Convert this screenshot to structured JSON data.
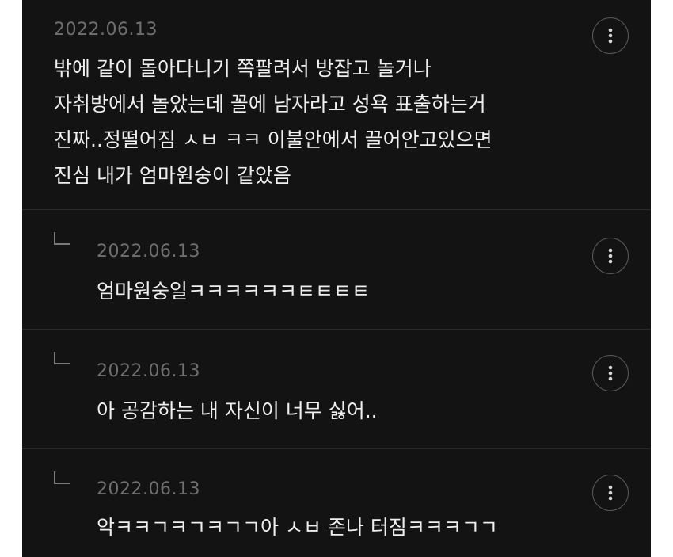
{
  "comments": [
    {
      "date": "2022.06.13",
      "lines": [
        "밖에 같이 돌아다니기 쪽팔려서 방잡고 놀거나",
        "자취방에서 놀았는데 꼴에 남자라고 성욕 표출하는거",
        "진짜..정떨어짐 ㅅㅂ ㅋㅋ 이불안에서 끌어안고있으면",
        "진심 내가 엄마원숭이 같았음"
      ]
    },
    {
      "date": "2022.06.13",
      "text": "엄마원숭일ㅋㅋㅋㅋㅋㅋㅌㅌㅌㅌ"
    },
    {
      "date": "2022.06.13",
      "text": "아 공감하는 내 자신이 너무 싫어.."
    },
    {
      "date": "2022.06.13",
      "text": "악ㅋㅋㄱㅋㄱㅋㄱㄱ아 ㅅㅂ 존나 터짐ㅋㅋㅋㄱㄱ"
    }
  ],
  "icons": {
    "more": "vertical-dots-icon",
    "reply": "reply-arrow-icon"
  },
  "colors": {
    "background": "#131313",
    "text": "#efefef",
    "date": "#6f6f6f",
    "divider": "#2a2a2a"
  }
}
